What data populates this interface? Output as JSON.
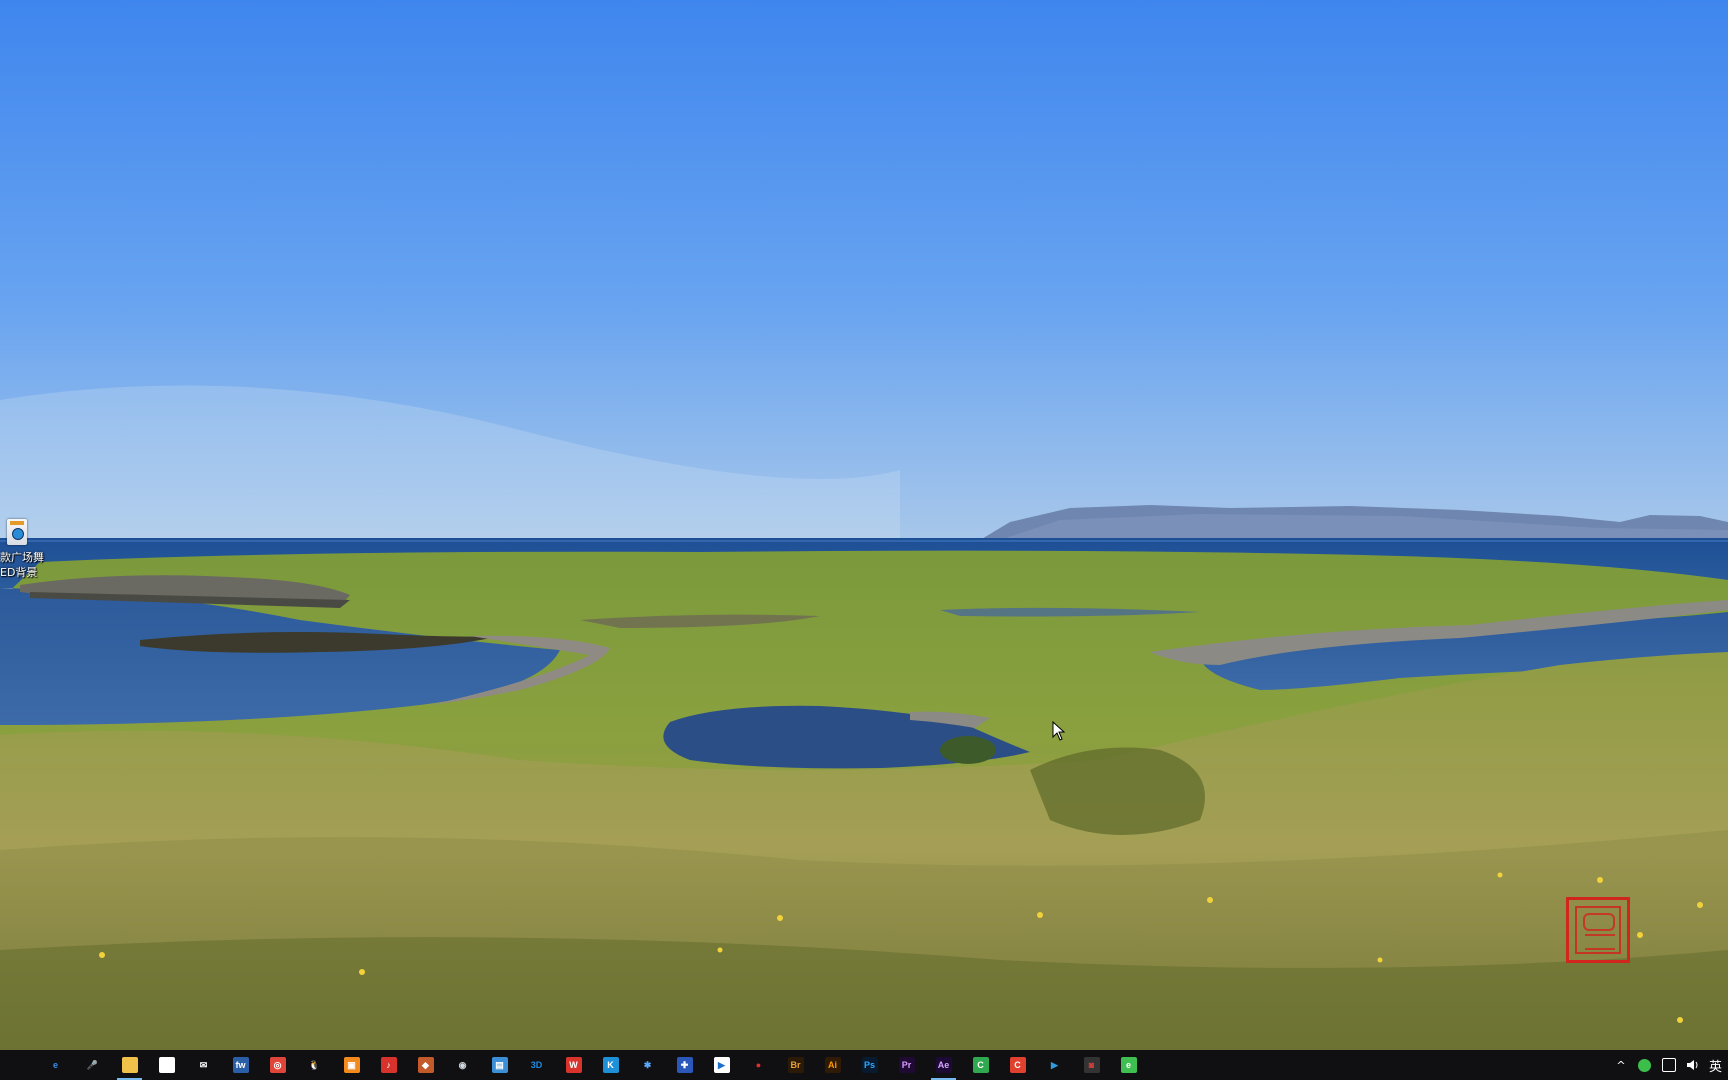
{
  "desktop": {
    "icon_label_line1": "款广场舞",
    "icon_label_line2": "ED背景"
  },
  "taskbar": {
    "apps": [
      {
        "name": "start-button",
        "glyph": "",
        "color": "#ffffff",
        "bg": "transparent"
      },
      {
        "name": "edge-icon",
        "glyph": "e",
        "color": "#3a8ee6",
        "bg": "transparent"
      },
      {
        "name": "microphone-icon",
        "glyph": "🎤",
        "color": "#dddddd",
        "bg": "transparent"
      },
      {
        "name": "file-explorer-icon",
        "glyph": "",
        "color": "#f4c542",
        "bg": "#f0c24a"
      },
      {
        "name": "store-icon",
        "glyph": "",
        "color": "#ffffff",
        "bg": "#ffffff"
      },
      {
        "name": "mail-icon",
        "glyph": "✉",
        "color": "#ffffff",
        "bg": "transparent"
      },
      {
        "name": "fw-app-icon",
        "glyph": "fw",
        "color": "#ffffff",
        "bg": "#2a5fa8"
      },
      {
        "name": "red-app-icon",
        "glyph": "◎",
        "color": "#ffffff",
        "bg": "#e0453a"
      },
      {
        "name": "qq-icon",
        "glyph": "🐧",
        "color": "#ffffff",
        "bg": "transparent"
      },
      {
        "name": "orange-app-icon",
        "glyph": "▣",
        "color": "#ffffff",
        "bg": "#f28a1e"
      },
      {
        "name": "music-app-icon",
        "glyph": "♪",
        "color": "#ffffff",
        "bg": "#d8322d"
      },
      {
        "name": "game-app-icon",
        "glyph": "◆",
        "color": "#ffffff",
        "bg": "#c25a2a"
      },
      {
        "name": "globe-app-icon",
        "glyph": "◉",
        "color": "#cfd6de",
        "bg": "transparent"
      },
      {
        "name": "blue-window-icon",
        "glyph": "▤",
        "color": "#ffffff",
        "bg": "#3c8fd6"
      },
      {
        "name": "3d-app-icon",
        "glyph": "3D",
        "color": "#1f8ce0",
        "bg": "transparent"
      },
      {
        "name": "wps-icon",
        "glyph": "W",
        "color": "#ffffff",
        "bg": "#d8342c"
      },
      {
        "name": "cyan-app-icon",
        "glyph": "K",
        "color": "#ffffff",
        "bg": "#1e90d8"
      },
      {
        "name": "network-app-icon",
        "glyph": "✱",
        "color": "#5aa8ff",
        "bg": "transparent"
      },
      {
        "name": "puzzle-app-icon",
        "glyph": "✚",
        "color": "#ffffff",
        "bg": "#2a57b8"
      },
      {
        "name": "player-app-icon",
        "glyph": "▶",
        "color": "#1b6ec9",
        "bg": "#ffffff"
      },
      {
        "name": "record-app-icon",
        "glyph": "●",
        "color": "#e3302a",
        "bg": "transparent"
      },
      {
        "name": "bridge-icon",
        "glyph": "Br",
        "color": "#e8a03a",
        "bg": "#2a1a06"
      },
      {
        "name": "illustrator-icon",
        "glyph": "Ai",
        "color": "#ff9a00",
        "bg": "#2e1a05"
      },
      {
        "name": "photoshop-icon",
        "glyph": "Ps",
        "color": "#31a8ff",
        "bg": "#081a2e"
      },
      {
        "name": "premiere-icon",
        "glyph": "Pr",
        "color": "#d89cff",
        "bg": "#1f0a33"
      },
      {
        "name": "after-effects-icon",
        "glyph": "Ae",
        "color": "#d6a5ff",
        "bg": "#1d0b36"
      },
      {
        "name": "camtasia-icon",
        "glyph": "C",
        "color": "#ffffff",
        "bg": "#2fa84f"
      },
      {
        "name": "capture-app-icon",
        "glyph": "C",
        "color": "#ffffff",
        "bg": "#e0402e"
      },
      {
        "name": "media-player-icon",
        "glyph": "▶",
        "color": "#2f9be0",
        "bg": "transparent"
      },
      {
        "name": "screen-recorder-icon",
        "glyph": "◙",
        "color": "#e0403a",
        "bg": "#333333"
      },
      {
        "name": "green-app-icon",
        "glyph": "e",
        "color": "#ffffff",
        "bg": "#3fbf4f"
      }
    ],
    "tray": {
      "chevron": "^",
      "ime": "英"
    }
  }
}
